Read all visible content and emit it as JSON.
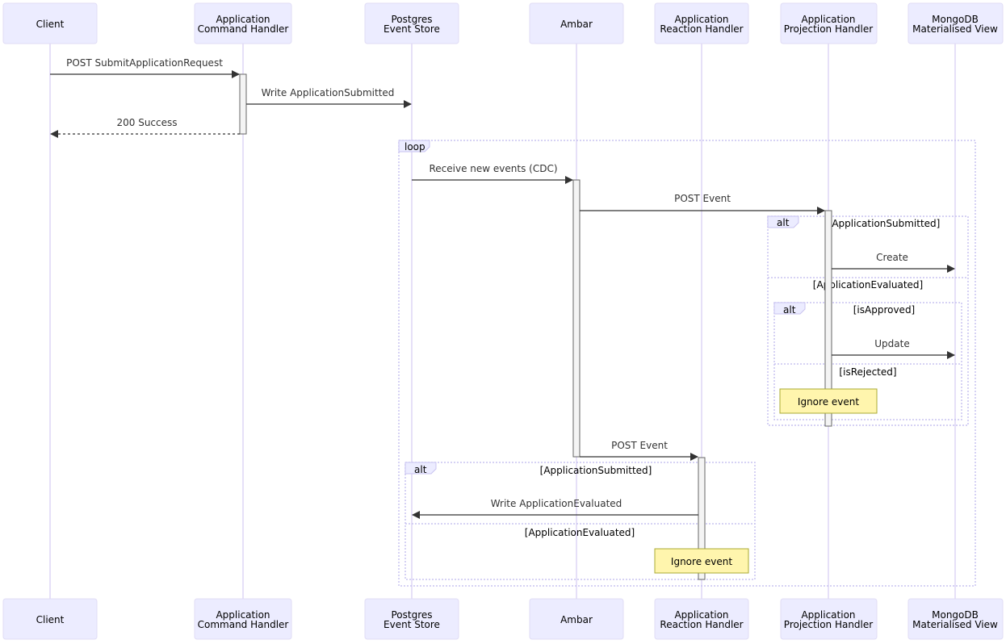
{
  "diagram": {
    "type": "sequence",
    "participants": [
      {
        "id": "client",
        "lines": [
          "Client"
        ]
      },
      {
        "id": "cmd",
        "lines": [
          "Application",
          "Command Handler"
        ]
      },
      {
        "id": "pg",
        "lines": [
          "Postgres",
          "Event Store"
        ]
      },
      {
        "id": "ambar",
        "lines": [
          "Ambar"
        ]
      },
      {
        "id": "react",
        "lines": [
          "Application",
          "Reaction Handler"
        ]
      },
      {
        "id": "proj",
        "lines": [
          "Application",
          "Projection Handler"
        ]
      },
      {
        "id": "mongo",
        "lines": [
          "MongoDB",
          "Materialised View"
        ]
      }
    ],
    "messages": [
      {
        "from": "client",
        "to": "cmd",
        "label": "POST SubmitApplicationRequest",
        "style": "solid"
      },
      {
        "from": "cmd",
        "to": "pg",
        "label": "Write ApplicationSubmitted",
        "style": "solid"
      },
      {
        "from": "cmd",
        "to": "client",
        "label": "200 Success",
        "style": "dotted"
      },
      {
        "from": "pg",
        "to": "ambar",
        "label": "Receive new events (CDC)",
        "style": "solid"
      },
      {
        "from": "ambar",
        "to": "proj",
        "label": "POST Event",
        "style": "solid"
      },
      {
        "from": "proj",
        "to": "mongo",
        "label": "Create",
        "style": "solid"
      },
      {
        "from": "proj",
        "to": "mongo",
        "label": "Update",
        "style": "solid"
      },
      {
        "from": "ambar",
        "to": "react",
        "label": "POST Event",
        "style": "solid"
      },
      {
        "from": "react",
        "to": "pg",
        "label": "Write ApplicationEvaluated",
        "style": "solid"
      }
    ],
    "frames": {
      "loop": {
        "label": "loop"
      },
      "alt_proj": {
        "label": "alt",
        "conditions": [
          "[ApplicationSubmitted]",
          "[ApplicationEvaluated]"
        ]
      },
      "alt_inner": {
        "label": "alt",
        "conditions": [
          "[isApproved]",
          "[isRejected]"
        ]
      },
      "alt_react": {
        "label": "alt",
        "conditions": [
          "[ApplicationSubmitted]",
          "[ApplicationEvaluated]"
        ]
      }
    },
    "notes": [
      {
        "over": "proj",
        "text": "Ignore event"
      },
      {
        "over": "react",
        "text": "Ignore event"
      }
    ]
  }
}
